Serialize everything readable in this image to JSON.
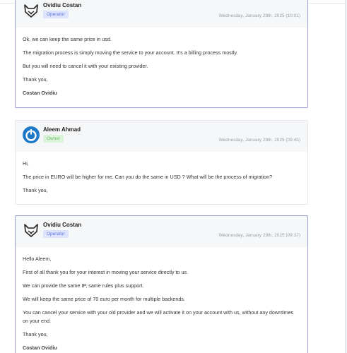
{
  "messages": [
    {
      "author": "Ovidiu Costan",
      "role": "Operator",
      "role_type": "operator",
      "avatar_icon": "fox-icon",
      "date": "Wednesday, January 29th, 2025 (10:01)",
      "lines": [
        "Ok, we can keep the same price in usd.",
        "The migration process is simply moving the service to your account. It's a billing process mostly.",
        "But you will need to cancel it with your existing provider.",
        "Thank you,",
        "Costan Ovidiu"
      ]
    },
    {
      "author": "Aleem Ahmad",
      "role": "Owner",
      "role_type": "owner",
      "avatar_icon": "power-icon",
      "date": "Wednesday, January 29th, 2025 (09:45)",
      "lines": [
        "Hi,",
        "The price in EURO will be higher for me. Can you do the same in USD ? What will be the process of migration?",
        "Thank you,"
      ]
    },
    {
      "author": "Ovidiu Costan",
      "role": "Operator",
      "role_type": "operator",
      "avatar_icon": "fox-icon",
      "date": "Wednesday, January 29th, 2025 (09:37)",
      "lines": [
        "Hello Aleem,",
        "First of all thank you for your interest in moving your service directly to us.",
        "We can provide the same IP, same rules plus support.",
        "We will keep the same price of 70 euro per month for multiple backends.",
        "You can cancel your service with your old provider and we will activate it on your account with us, without any downtimes on your end.",
        "Thank you,",
        "Costan Ovidiu"
      ]
    }
  ],
  "colors": {
    "operator_border": "#9aa0d6",
    "operator_badge_bg": "#dde4ff",
    "operator_badge_text": "#5b73d9",
    "owner_badge_bg": "#ddf4dc",
    "owner_badge_text": "#6cbf6a",
    "owner_avatar": "#1e78c8"
  }
}
